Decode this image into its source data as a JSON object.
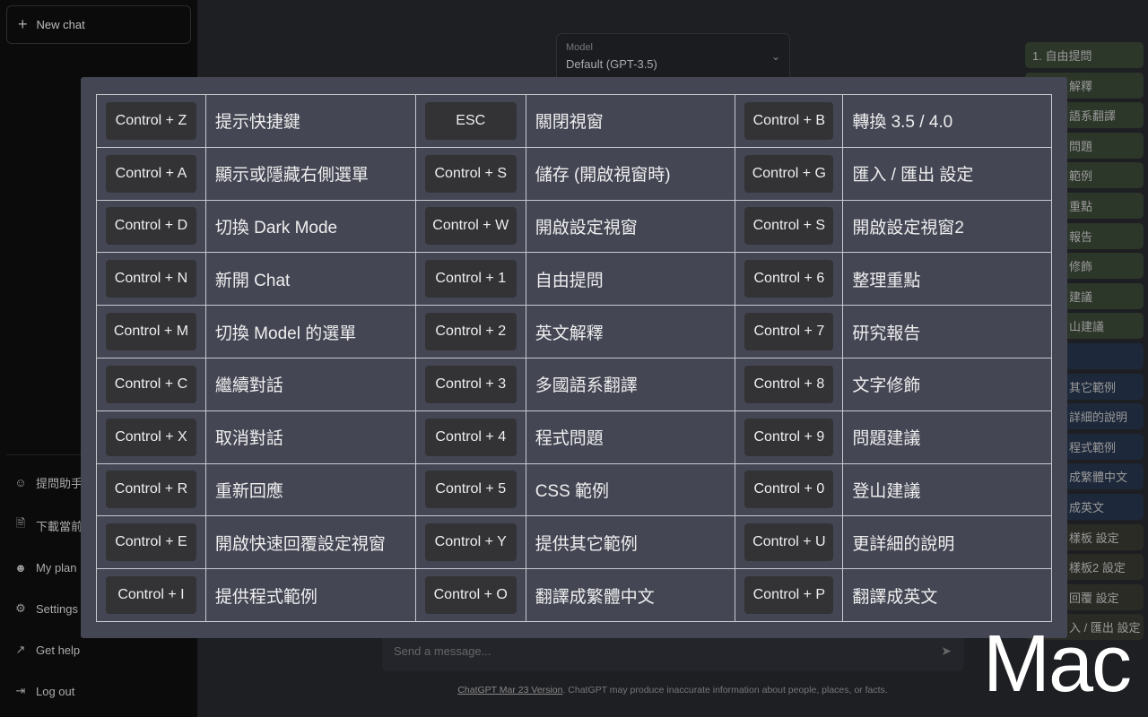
{
  "sidebar": {
    "new_chat": "New chat",
    "items": [
      {
        "icon": "user-assistant-icon",
        "label": "提問助手"
      },
      {
        "icon": "file-download-icon",
        "label": "下載當前"
      },
      {
        "icon": "user-icon",
        "label": "My plan"
      },
      {
        "icon": "gear-icon",
        "label": "Settings"
      },
      {
        "icon": "external-link-icon",
        "label": "Get help"
      },
      {
        "icon": "logout-icon",
        "label": "Log out"
      }
    ]
  },
  "model": {
    "label": "Model",
    "value": "Default (GPT-3.5)"
  },
  "right_panel": [
    {
      "label": "1. 自由提問",
      "color": "green"
    },
    {
      "label": "解釋",
      "color": "green"
    },
    {
      "label": "語系翻譯",
      "color": "green"
    },
    {
      "label": "問題",
      "color": "green"
    },
    {
      "label": "範例",
      "color": "green"
    },
    {
      "label": "重點",
      "color": "green"
    },
    {
      "label": "報告",
      "color": "green"
    },
    {
      "label": "修飾",
      "color": "green"
    },
    {
      "label": "建議",
      "color": "green"
    },
    {
      "label": "山建議",
      "color": "green"
    },
    {
      "label": "",
      "color": "blue"
    },
    {
      "label": "其它範例",
      "color": "blue"
    },
    {
      "label": "詳細的說明",
      "color": "blue"
    },
    {
      "label": "程式範例",
      "color": "blue"
    },
    {
      "label": "成繁體中文",
      "color": "blue"
    },
    {
      "label": "成英文",
      "color": "blue"
    },
    {
      "label": "樣板 設定",
      "color": "olive"
    },
    {
      "label": "樣板2 設定",
      "color": "olive"
    },
    {
      "label": "回覆 設定",
      "color": "olive"
    },
    {
      "label": "入 / 匯出 設定",
      "color": "olive"
    }
  ],
  "message": {
    "placeholder": "Send a message..."
  },
  "footer": {
    "link": "ChatGPT Mar 23 Version",
    "text": ". ChatGPT may produce inaccurate information about people, places, or facts."
  },
  "shortcuts": [
    [
      {
        "key": "Control + Z",
        "desc": "提示快捷鍵"
      },
      {
        "key": "ESC",
        "desc": "關閉視窗"
      },
      {
        "key": "Control + B",
        "desc": "轉換 3.5 / 4.0"
      }
    ],
    [
      {
        "key": "Control + A",
        "desc": "顯示或隱藏右側選單"
      },
      {
        "key": "Control + S",
        "desc": "儲存 (開啟視窗時)"
      },
      {
        "key": "Control + G",
        "desc": "匯入 / 匯出 設定"
      }
    ],
    [
      {
        "key": "Control + D",
        "desc": "切換 Dark Mode"
      },
      {
        "key": "Control + W",
        "desc": "開啟設定視窗"
      },
      {
        "key": "Control + S",
        "desc": "開啟設定視窗2"
      }
    ],
    [
      {
        "key": "Control + N",
        "desc": "新開 Chat"
      },
      {
        "key": "Control + 1",
        "desc": "自由提問"
      },
      {
        "key": "Control + 6",
        "desc": "整理重點"
      }
    ],
    [
      {
        "key": "Control + M",
        "desc": "切換 Model 的選單"
      },
      {
        "key": "Control + 2",
        "desc": "英文解釋"
      },
      {
        "key": "Control + 7",
        "desc": "研究報告"
      }
    ],
    [
      {
        "key": "Control + C",
        "desc": "繼續對話"
      },
      {
        "key": "Control + 3",
        "desc": "多國語系翻譯"
      },
      {
        "key": "Control + 8",
        "desc": "文字修飾"
      }
    ],
    [
      {
        "key": "Control + X",
        "desc": "取消對話"
      },
      {
        "key": "Control + 4",
        "desc": "程式問題"
      },
      {
        "key": "Control + 9",
        "desc": "問題建議"
      }
    ],
    [
      {
        "key": "Control + R",
        "desc": "重新回應"
      },
      {
        "key": "Control + 5",
        "desc": "CSS 範例"
      },
      {
        "key": "Control + 0",
        "desc": "登山建議"
      }
    ],
    [
      {
        "key": "Control + E",
        "desc": "開啟快速回覆設定視窗"
      },
      {
        "key": "Control + Y",
        "desc": "提供其它範例"
      },
      {
        "key": "Control + U",
        "desc": "更詳細的說明"
      }
    ],
    [
      {
        "key": "Control + I",
        "desc": "提供程式範例"
      },
      {
        "key": "Control + O",
        "desc": "翻譯成繁體中文"
      },
      {
        "key": "Control + P",
        "desc": "翻譯成英文"
      }
    ]
  ],
  "watermark": "Mac"
}
